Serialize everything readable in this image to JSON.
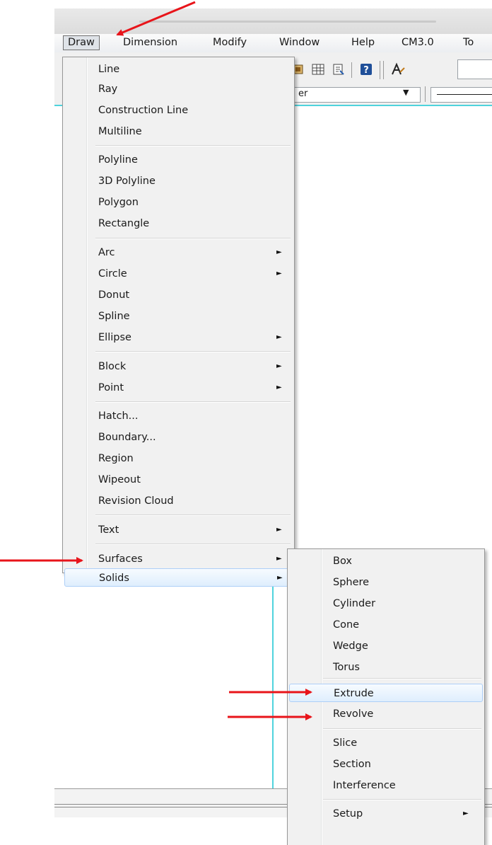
{
  "menubar": {
    "items": [
      "Draw",
      "Dimension",
      "Modify",
      "Window",
      "Help",
      "CM3.0",
      "To"
    ]
  },
  "toolbar": {
    "layer_combo_text": "er",
    "icons": [
      "render-icon",
      "table-icon",
      "properties-icon",
      "help-icon",
      "text-style-icon"
    ]
  },
  "draw_menu": {
    "items": [
      {
        "label": "Line",
        "submenu": false
      },
      {
        "label": "Ray",
        "submenu": false
      },
      {
        "label": "Construction Line",
        "submenu": false
      },
      {
        "label": "Multiline",
        "submenu": false
      },
      {
        "label": "Polyline",
        "submenu": false
      },
      {
        "label": "3D Polyline",
        "submenu": false
      },
      {
        "label": "Polygon",
        "submenu": false
      },
      {
        "label": "Rectangle",
        "submenu": false
      },
      {
        "label": "Arc",
        "submenu": true
      },
      {
        "label": "Circle",
        "submenu": true
      },
      {
        "label": "Donut",
        "submenu": false
      },
      {
        "label": "Spline",
        "submenu": false
      },
      {
        "label": "Ellipse",
        "submenu": true
      },
      {
        "label": "Block",
        "submenu": true
      },
      {
        "label": "Point",
        "submenu": true
      },
      {
        "label": "Hatch...",
        "submenu": false
      },
      {
        "label": "Boundary...",
        "submenu": false
      },
      {
        "label": "Region",
        "submenu": false
      },
      {
        "label": "Wipeout",
        "submenu": false
      },
      {
        "label": "Revision Cloud",
        "submenu": false
      },
      {
        "label": "Text",
        "submenu": true
      },
      {
        "label": "Surfaces",
        "submenu": true
      },
      {
        "label": "Solids",
        "submenu": true,
        "highlighted": true
      }
    ]
  },
  "solids_menu": {
    "items": [
      {
        "label": "Box",
        "submenu": false
      },
      {
        "label": "Sphere",
        "submenu": false
      },
      {
        "label": "Cylinder",
        "submenu": false
      },
      {
        "label": "Cone",
        "submenu": false
      },
      {
        "label": "Wedge",
        "submenu": false
      },
      {
        "label": "Torus",
        "submenu": false
      },
      {
        "label": "Extrude",
        "submenu": false,
        "highlighted": true
      },
      {
        "label": "Revolve",
        "submenu": false
      },
      {
        "label": "Slice",
        "submenu": false
      },
      {
        "label": "Section",
        "submenu": false
      },
      {
        "label": "Interference",
        "submenu": false
      },
      {
        "label": "Setup",
        "submenu": true
      }
    ]
  },
  "colors": {
    "annotation_arrow": "#e8141a",
    "menu_background": "#f1f1f1",
    "highlight_border": "#aecff7",
    "canvas_guide": "#4fd3dd"
  },
  "annotations": [
    "arrow-to-draw-menu",
    "arrow-to-solids",
    "arrow-to-extrude",
    "arrow-to-revolve"
  ]
}
